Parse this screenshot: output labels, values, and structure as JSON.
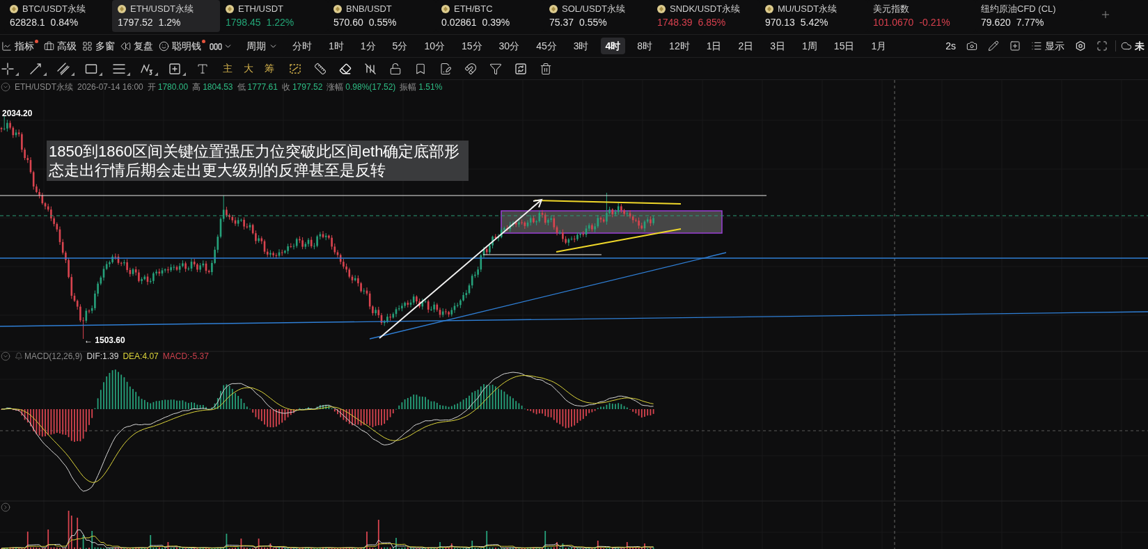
{
  "tickers": [
    {
      "name": "BTC/USDT永续",
      "price": "62828.1",
      "change": "0.84%",
      "kind": "coin",
      "selected": false,
      "color": "#e6e6e6"
    },
    {
      "name": "ETH/USDT永续",
      "price": "1797.52",
      "change": "1.2%",
      "kind": "coin",
      "selected": true,
      "color": "#e6e6e6"
    },
    {
      "name": "ETH/USDT",
      "price": "1798.45",
      "change": "1.22%",
      "kind": "coin",
      "selected": false,
      "color": "#23a677"
    },
    {
      "name": "BNB/USDT",
      "price": "570.60",
      "change": "0.55%",
      "kind": "coin",
      "selected": false,
      "color": "#e6e6e6"
    },
    {
      "name": "ETH/BTC",
      "price": "0.02861",
      "change": "0.39%",
      "kind": "coin",
      "selected": false,
      "color": "#e6e6e6"
    },
    {
      "name": "SOL/USDT永续",
      "price": "75.37",
      "change": "0.55%",
      "kind": "coin",
      "selected": false,
      "color": "#e6e6e6"
    },
    {
      "name": "SNDK/USDT永续",
      "price": "1748.39",
      "change": "6.85%",
      "kind": "coin",
      "selected": false,
      "color": "#d8404e"
    },
    {
      "name": "MU/USDT永续",
      "price": "970.13",
      "change": "5.42%",
      "kind": "coin",
      "selected": false,
      "color": "#e6e6e6"
    },
    {
      "name": "美元指数",
      "price": "101.0670",
      "change": "-0.21%",
      "kind": "index",
      "selected": false,
      "color": "#d8404e"
    },
    {
      "name": "纽约原油CFD (CL)",
      "price": "79.620",
      "change": "7.77%",
      "kind": "index",
      "selected": false,
      "color": "#e6e6e6"
    }
  ],
  "toolbar": {
    "tools": [
      {
        "label": "指标",
        "dot": true
      },
      {
        "label": "高级",
        "dot": false
      },
      {
        "label": "多窗",
        "dot": false
      },
      {
        "label": "复盘",
        "dot": false
      },
      {
        "label": "聪明钱",
        "dot": true
      }
    ],
    "period_menu": "周期",
    "timeframes": [
      {
        "label": "分时",
        "selected": false
      },
      {
        "label": "1时",
        "selected": false
      },
      {
        "label": "1分",
        "selected": false
      },
      {
        "label": "5分",
        "selected": false
      },
      {
        "label": "10分",
        "selected": false
      },
      {
        "label": "15分",
        "selected": false
      },
      {
        "label": "30分",
        "selected": false
      },
      {
        "label": "45分",
        "selected": false
      },
      {
        "label": "3时",
        "selected": false
      },
      {
        "label": "4时",
        "selected": true
      },
      {
        "label": "8时",
        "selected": false
      },
      {
        "label": "12时",
        "selected": false
      },
      {
        "label": "1日",
        "selected": false
      },
      {
        "label": "2日",
        "selected": false
      },
      {
        "label": "3日",
        "selected": false
      },
      {
        "label": "1周",
        "selected": false
      },
      {
        "label": "15日",
        "selected": false
      },
      {
        "label": "1月",
        "selected": false
      }
    ],
    "interval": "2s",
    "display_menu": "显示",
    "cloud_status": "未"
  },
  "drawing_tools": [
    {
      "kind": "icon",
      "menu": true
    },
    {
      "kind": "icon",
      "menu": true
    },
    {
      "kind": "icon",
      "menu": true
    },
    {
      "kind": "icon",
      "menu": true
    },
    {
      "kind": "icon",
      "menu": true
    },
    {
      "kind": "icon",
      "menu": true
    },
    {
      "kind": "icon",
      "menu": true
    },
    {
      "kind": "icon",
      "menu": false
    },
    {
      "kind": "text",
      "label": "主"
    },
    {
      "kind": "text",
      "label": "大"
    },
    {
      "kind": "text",
      "label": "筹"
    },
    {
      "kind": "icon",
      "menu": false
    },
    {
      "kind": "icon",
      "menu": false
    },
    {
      "kind": "icon",
      "menu": false
    },
    {
      "kind": "icon",
      "menu": false
    },
    {
      "kind": "icon",
      "menu": false
    },
    {
      "kind": "icon",
      "menu": false
    },
    {
      "kind": "icon",
      "menu": false
    },
    {
      "kind": "icon",
      "menu": false
    },
    {
      "kind": "icon",
      "menu": false
    },
    {
      "kind": "icon",
      "menu": false
    },
    {
      "kind": "icon",
      "menu": false
    }
  ],
  "bar_info": {
    "symbol": "ETH/USDT永续",
    "time": "2026-07-14 16:00",
    "rising": true,
    "fields": [
      {
        "label": "开",
        "value": "1780.00"
      },
      {
        "label": "高",
        "value": "1804.53"
      },
      {
        "label": "低",
        "value": "1777.61"
      },
      {
        "label": "收",
        "value": "1797.52"
      },
      {
        "label": "涨幅",
        "value": "0.98%(17.52)"
      },
      {
        "label": "振幅",
        "value": "1.51%"
      }
    ]
  },
  "price_chart": {
    "high_label": "2034.20",
    "low_label": "← 1503.60",
    "note": "1850到1860区间关键位置强压力位突破此区间eth确定底部形态走出行情后期会走出更大级别的反弹甚至是反转"
  },
  "macd": {
    "title": "MACD(12,26,9)",
    "values": [
      {
        "label": "DIF:1.39",
        "color": "#d6d6d6"
      },
      {
        "label": "DEA:4.07",
        "color": "#dcd43a"
      },
      {
        "label": "MACD:-5.37",
        "color": "#c9404c"
      }
    ]
  }
}
